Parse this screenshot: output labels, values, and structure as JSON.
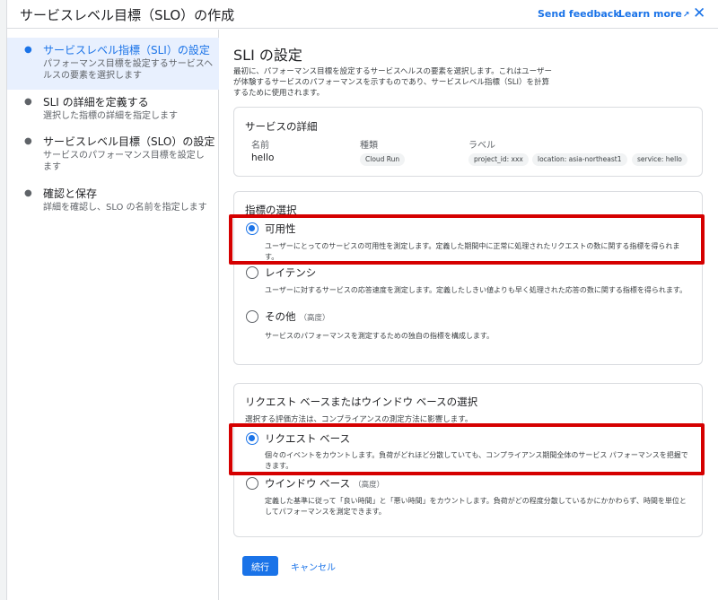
{
  "header": {
    "title": "サービスレベル目標（SLO）の作成",
    "send_feedback": "Send feedback",
    "learn_more": "Learn more",
    "close_glyph": "✕",
    "icons": [
      "external-link-icon",
      "close-icon"
    ]
  },
  "stepper": {
    "steps": [
      {
        "title": "サービスレベル指標（SLI）の設定",
        "desc": "パフォーマンス目標を設定するサービスヘルスの要素を選択します"
      },
      {
        "title": "SLI の詳細を定義する",
        "desc": "選択した指標の詳細を指定します"
      },
      {
        "title": "サービスレベル目標（SLO）の設定",
        "desc": "サービスのパフォーマンス目標を設定します"
      },
      {
        "title": "確認と保存",
        "desc": "詳細を確認し、SLO の名前を指定します"
      }
    ]
  },
  "main": {
    "title": "SLI の設定",
    "intro": "最初に、パフォーマンス目標を設定するサービスヘルスの要素を選択します。これはユーザーが体験するサービスのパフォーマンスを示すものであり、サービスレベル指標（SLI）を計算するために使用されます。",
    "service_details": {
      "title": "サービスの詳細",
      "name_header": "名前",
      "type_header": "種類",
      "label_header": "ラベル",
      "name_value": "hello",
      "type_value": "Cloud Run",
      "labels": [
        "project_id: xxx",
        "location: asia-northeast1",
        "service: hello"
      ]
    },
    "metric_select": {
      "title": "指標の選択",
      "options": [
        {
          "label": "可用性",
          "advanced": "",
          "desc": "ユーザーにとってのサービスの可用性を測定します。定義した期間中に正常に処理されたリクエストの数に関する指標を得られます。",
          "selected": true
        },
        {
          "label": "レイテンシ",
          "advanced": "",
          "desc": "ユーザーに対するサービスの応答速度を測定します。定義したしきい値よりも早く処理された応答の数に関する指標を得られます。",
          "selected": false
        },
        {
          "label": "その他",
          "advanced": "（高度）",
          "desc": "サービスのパフォーマンスを測定するための独自の指標を構成します。",
          "selected": false
        }
      ]
    },
    "request_window": {
      "title": "リクエスト ベースまたはウインドウ ベースの選択",
      "subtitle": "選択する評価方法は、コンプライアンスの測定方法に影響します。",
      "options": [
        {
          "label": "リクエスト ベース",
          "advanced": "",
          "desc": "個々のイベントをカウントします。負荷がどれほど分散していても、コンプライアンス期間全体のサービス パフォーマンスを把握できます。",
          "selected": true
        },
        {
          "label": "ウインドウ ベース",
          "advanced": "（高度）",
          "desc": "定義した基準に従って「良い時間」と「悪い時間」をカウントします。負荷がどの程度分散しているかにかかわらず、時間を単位としてパフォーマンスを測定できます。",
          "selected": false
        }
      ]
    },
    "continue_label": "続行",
    "cancel_label": "キャンセル"
  },
  "colors": {
    "accent": "#1a73e8",
    "highlight": "#d50000",
    "active_step_bg": "#e8f0fe"
  }
}
